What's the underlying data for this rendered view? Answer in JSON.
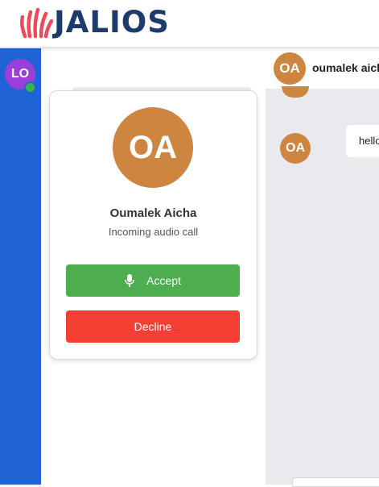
{
  "header": {
    "logo_text": "JALIOS",
    "colors": {
      "logo_text": "#1e3b6e",
      "logo_mark": "#f04a5a"
    }
  },
  "rail": {
    "user_initials": "LO",
    "status": "online",
    "colors": {
      "background": "#1f63d6",
      "avatar": "#9b3fd8",
      "presence": "#3bb54a"
    }
  },
  "call": {
    "avatar_initials": "OA",
    "caller_name": "Oumalek Aicha",
    "status_text": "Incoming audio call",
    "accept_label": "Accept",
    "accept_icon": "microphone-icon",
    "decline_label": "Decline",
    "colors": {
      "avatar": "#cd8540",
      "accept": "#4cae4f",
      "decline": "#f53f35"
    }
  },
  "chat": {
    "header_initials": "OA",
    "header_name": "oumalek aicha",
    "messages": [
      {
        "avatar_initials": "OA",
        "text": "hello"
      }
    ],
    "colors": {
      "background": "#e9eaed"
    }
  }
}
